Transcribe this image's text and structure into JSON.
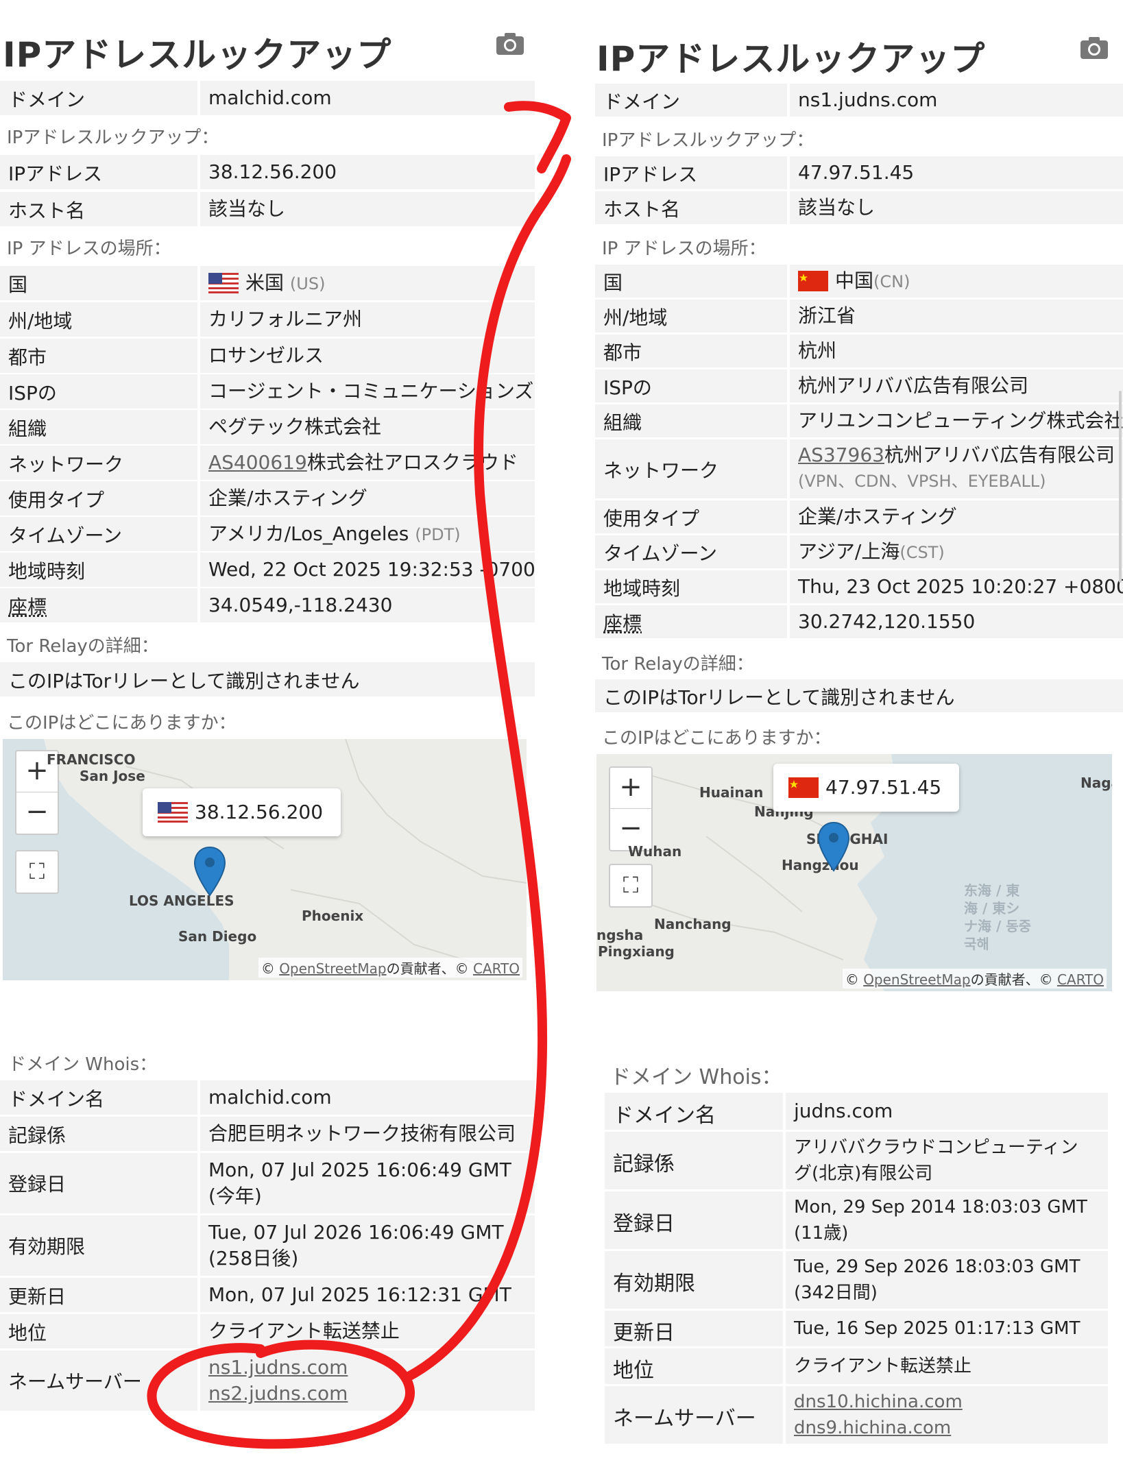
{
  "colors": {
    "annotation": "#ee1c1c",
    "marker": "#2a81cb",
    "row_bg": "#f3f3f3"
  },
  "left": {
    "title": "IPアドレスルックアップ",
    "camera_icon": "camera-icon",
    "domain_label": "ドメイン",
    "domain_value": "malchid.com",
    "lookup_section": "IPアドレスルックアップ：",
    "ip_label": "IPアドレス",
    "ip_value": "38.12.56.200",
    "host_label": "ホスト名",
    "host_value": "該当なし",
    "location_section": "IP アドレスの場所：",
    "country_label": "国",
    "country_name": "米国",
    "country_code": "(US)",
    "state_label": "州/地域",
    "state_value": "カリフォルニア州",
    "city_label": "都市",
    "city_value": "ロサンゼルス",
    "isp_label": "ISPの",
    "isp_value": "コージェント・コミュニケーションズ",
    "org_label": "組織",
    "org_value": "ペグテック株式会社",
    "network_label": "ネットワーク",
    "network_as": "AS400619",
    "network_name": "株式会社アロスクラウド",
    "usage_label": "使用タイプ",
    "usage_value": "企業/ホスティング",
    "tz_label": "タイムゾーン",
    "tz_value": "アメリカ/Los_Angeles",
    "tz_abbr": "(PDT)",
    "localtime_label": "地域時刻",
    "localtime_value": "Wed, 22 Oct 2025 19:32:53 -0700",
    "coords_label": "座標",
    "coords_value": "34.0549,-118.2430",
    "tor_section": "Tor Relayの詳細：",
    "tor_value": "このIPはTorリレーとして識別されません",
    "where_section": "このIPはどこにありますか：",
    "map": {
      "zoom_in": "+",
      "zoom_out": "−",
      "tooltip_ip": "38.12.56.200",
      "cities": [
        "FRANCISCO",
        "San Jose",
        "LOS ANGELES",
        "Phoenix",
        "San Diego"
      ],
      "attr_prefix": "© ",
      "attr_osm": "OpenStreetMap",
      "attr_mid": "の貢献者、© ",
      "attr_carto": "CARTO"
    },
    "whois_section": "ドメイン Whois：",
    "whois_domain_label": "ドメイン名",
    "whois_domain_value": "malchid.com",
    "registrar_label": "記録係",
    "registrar_value": "合肥巨明ネットワーク技術有限公司",
    "created_label": "登録日",
    "created_value": "Mon, 07 Jul 2025 16:06:49 GMT (今年)",
    "expires_label": "有効期限",
    "expires_value": "Tue, 07 Jul 2026 16:06:49 GMT (258日後)",
    "updated_label": "更新日",
    "updated_value": "Mon, 07 Jul 2025 16:12:31 GMT",
    "status_label": "地位",
    "status_value": "クライアント転送禁止",
    "ns_label": "ネームサーバー",
    "ns": [
      "ns1.judns.com",
      "ns2.judns.com"
    ]
  },
  "right": {
    "title": "IPアドレスルックアップ",
    "camera_icon": "camera-icon",
    "domain_label": "ドメイン",
    "domain_value": "ns1.judns.com",
    "lookup_section": "IPアドレスルックアップ：",
    "ip_label": "IPアドレス",
    "ip_value": "47.97.51.45",
    "host_label": "ホスト名",
    "host_value": "該当なし",
    "location_section": "IP アドレスの場所：",
    "country_label": "国",
    "country_name": "中国",
    "country_code": "(CN)",
    "state_label": "州/地域",
    "state_value": "浙江省",
    "city_label": "都市",
    "city_value": "杭州",
    "isp_label": "ISPの",
    "isp_value": "杭州アリババ広告有限公司",
    "org_label": "組織",
    "org_value": "アリユンコンピューティング株式会社",
    "network_label": "ネットワーク",
    "network_as": "AS37963",
    "network_name": "杭州アリババ広告有限公司",
    "network_tags": "(VPN、CDN、VPSH、EYEBALL)",
    "usage_label": "使用タイプ",
    "usage_value": "企業/ホスティング",
    "tz_label": "タイムゾーン",
    "tz_value": "アジア/上海",
    "tz_abbr": "(CST)",
    "localtime_label": "地域時刻",
    "localtime_value": "Thu, 23 Oct 2025 10:20:27 +0800",
    "coords_label": "座標",
    "coords_value": "30.2742,120.1550",
    "tor_section": "Tor Relayの詳細：",
    "tor_value": "このIPはTorリレーとして識別されません",
    "where_section": "このIPはどこにありますか：",
    "map": {
      "zoom_in": "+",
      "zoom_out": "−",
      "tooltip_ip": "47.97.51.45",
      "cities": [
        "Huainan",
        "Nanjing",
        "SHANGHAI",
        "Hangzhou",
        "Wuhan",
        "Nanchang",
        "ngsha",
        "Pingxiang",
        "Naga"
      ],
      "sea_label": "东海 / 東海 / 東シナ海 / 동중국해",
      "attr_prefix": "© ",
      "attr_osm": "OpenStreetMap",
      "attr_mid": "の貢献者、© ",
      "attr_carto": "CARTO"
    },
    "whois_section": "ドメイン Whois：",
    "whois_domain_label": "ドメイン名",
    "whois_domain_value": "judns.com",
    "registrar_label": "記録係",
    "registrar_value": "アリババクラウドコンピューティング(北京)有限公司",
    "created_label": "登録日",
    "created_value": "Mon, 29 Sep 2014 18:03:03 GMT (11歳)",
    "expires_label": "有効期限",
    "expires_value": "Tue, 29 Sep 2026 18:03:03 GMT (342日間)",
    "updated_label": "更新日",
    "updated_value": "Tue, 16 Sep 2025 01:17:13 GMT",
    "status_label": "地位",
    "status_value": "クライアント転送禁止",
    "ns_label": "ネームサーバー",
    "ns": [
      "dns10.hichina.com",
      "dns9.hichina.com"
    ]
  }
}
